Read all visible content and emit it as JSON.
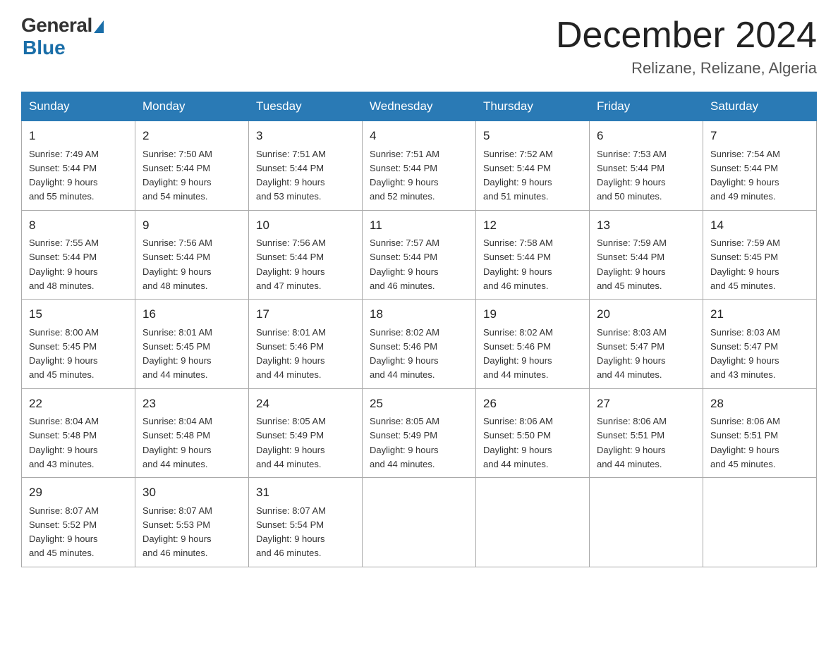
{
  "header": {
    "logo_general": "General",
    "logo_blue": "Blue",
    "month_title": "December 2024",
    "location": "Relizane, Relizane, Algeria"
  },
  "days_of_week": [
    "Sunday",
    "Monday",
    "Tuesday",
    "Wednesday",
    "Thursday",
    "Friday",
    "Saturday"
  ],
  "weeks": [
    [
      {
        "num": "1",
        "sunrise": "7:49 AM",
        "sunset": "5:44 PM",
        "daylight": "9 hours and 55 minutes."
      },
      {
        "num": "2",
        "sunrise": "7:50 AM",
        "sunset": "5:44 PM",
        "daylight": "9 hours and 54 minutes."
      },
      {
        "num": "3",
        "sunrise": "7:51 AM",
        "sunset": "5:44 PM",
        "daylight": "9 hours and 53 minutes."
      },
      {
        "num": "4",
        "sunrise": "7:51 AM",
        "sunset": "5:44 PM",
        "daylight": "9 hours and 52 minutes."
      },
      {
        "num": "5",
        "sunrise": "7:52 AM",
        "sunset": "5:44 PM",
        "daylight": "9 hours and 51 minutes."
      },
      {
        "num": "6",
        "sunrise": "7:53 AM",
        "sunset": "5:44 PM",
        "daylight": "9 hours and 50 minutes."
      },
      {
        "num": "7",
        "sunrise": "7:54 AM",
        "sunset": "5:44 PM",
        "daylight": "9 hours and 49 minutes."
      }
    ],
    [
      {
        "num": "8",
        "sunrise": "7:55 AM",
        "sunset": "5:44 PM",
        "daylight": "9 hours and 48 minutes."
      },
      {
        "num": "9",
        "sunrise": "7:56 AM",
        "sunset": "5:44 PM",
        "daylight": "9 hours and 48 minutes."
      },
      {
        "num": "10",
        "sunrise": "7:56 AM",
        "sunset": "5:44 PM",
        "daylight": "9 hours and 47 minutes."
      },
      {
        "num": "11",
        "sunrise": "7:57 AM",
        "sunset": "5:44 PM",
        "daylight": "9 hours and 46 minutes."
      },
      {
        "num": "12",
        "sunrise": "7:58 AM",
        "sunset": "5:44 PM",
        "daylight": "9 hours and 46 minutes."
      },
      {
        "num": "13",
        "sunrise": "7:59 AM",
        "sunset": "5:44 PM",
        "daylight": "9 hours and 45 minutes."
      },
      {
        "num": "14",
        "sunrise": "7:59 AM",
        "sunset": "5:45 PM",
        "daylight": "9 hours and 45 minutes."
      }
    ],
    [
      {
        "num": "15",
        "sunrise": "8:00 AM",
        "sunset": "5:45 PM",
        "daylight": "9 hours and 45 minutes."
      },
      {
        "num": "16",
        "sunrise": "8:01 AM",
        "sunset": "5:45 PM",
        "daylight": "9 hours and 44 minutes."
      },
      {
        "num": "17",
        "sunrise": "8:01 AM",
        "sunset": "5:46 PM",
        "daylight": "9 hours and 44 minutes."
      },
      {
        "num": "18",
        "sunrise": "8:02 AM",
        "sunset": "5:46 PM",
        "daylight": "9 hours and 44 minutes."
      },
      {
        "num": "19",
        "sunrise": "8:02 AM",
        "sunset": "5:46 PM",
        "daylight": "9 hours and 44 minutes."
      },
      {
        "num": "20",
        "sunrise": "8:03 AM",
        "sunset": "5:47 PM",
        "daylight": "9 hours and 44 minutes."
      },
      {
        "num": "21",
        "sunrise": "8:03 AM",
        "sunset": "5:47 PM",
        "daylight": "9 hours and 43 minutes."
      }
    ],
    [
      {
        "num": "22",
        "sunrise": "8:04 AM",
        "sunset": "5:48 PM",
        "daylight": "9 hours and 43 minutes."
      },
      {
        "num": "23",
        "sunrise": "8:04 AM",
        "sunset": "5:48 PM",
        "daylight": "9 hours and 44 minutes."
      },
      {
        "num": "24",
        "sunrise": "8:05 AM",
        "sunset": "5:49 PM",
        "daylight": "9 hours and 44 minutes."
      },
      {
        "num": "25",
        "sunrise": "8:05 AM",
        "sunset": "5:49 PM",
        "daylight": "9 hours and 44 minutes."
      },
      {
        "num": "26",
        "sunrise": "8:06 AM",
        "sunset": "5:50 PM",
        "daylight": "9 hours and 44 minutes."
      },
      {
        "num": "27",
        "sunrise": "8:06 AM",
        "sunset": "5:51 PM",
        "daylight": "9 hours and 44 minutes."
      },
      {
        "num": "28",
        "sunrise": "8:06 AM",
        "sunset": "5:51 PM",
        "daylight": "9 hours and 45 minutes."
      }
    ],
    [
      {
        "num": "29",
        "sunrise": "8:07 AM",
        "sunset": "5:52 PM",
        "daylight": "9 hours and 45 minutes."
      },
      {
        "num": "30",
        "sunrise": "8:07 AM",
        "sunset": "5:53 PM",
        "daylight": "9 hours and 46 minutes."
      },
      {
        "num": "31",
        "sunrise": "8:07 AM",
        "sunset": "5:54 PM",
        "daylight": "9 hours and 46 minutes."
      },
      null,
      null,
      null,
      null
    ]
  ]
}
